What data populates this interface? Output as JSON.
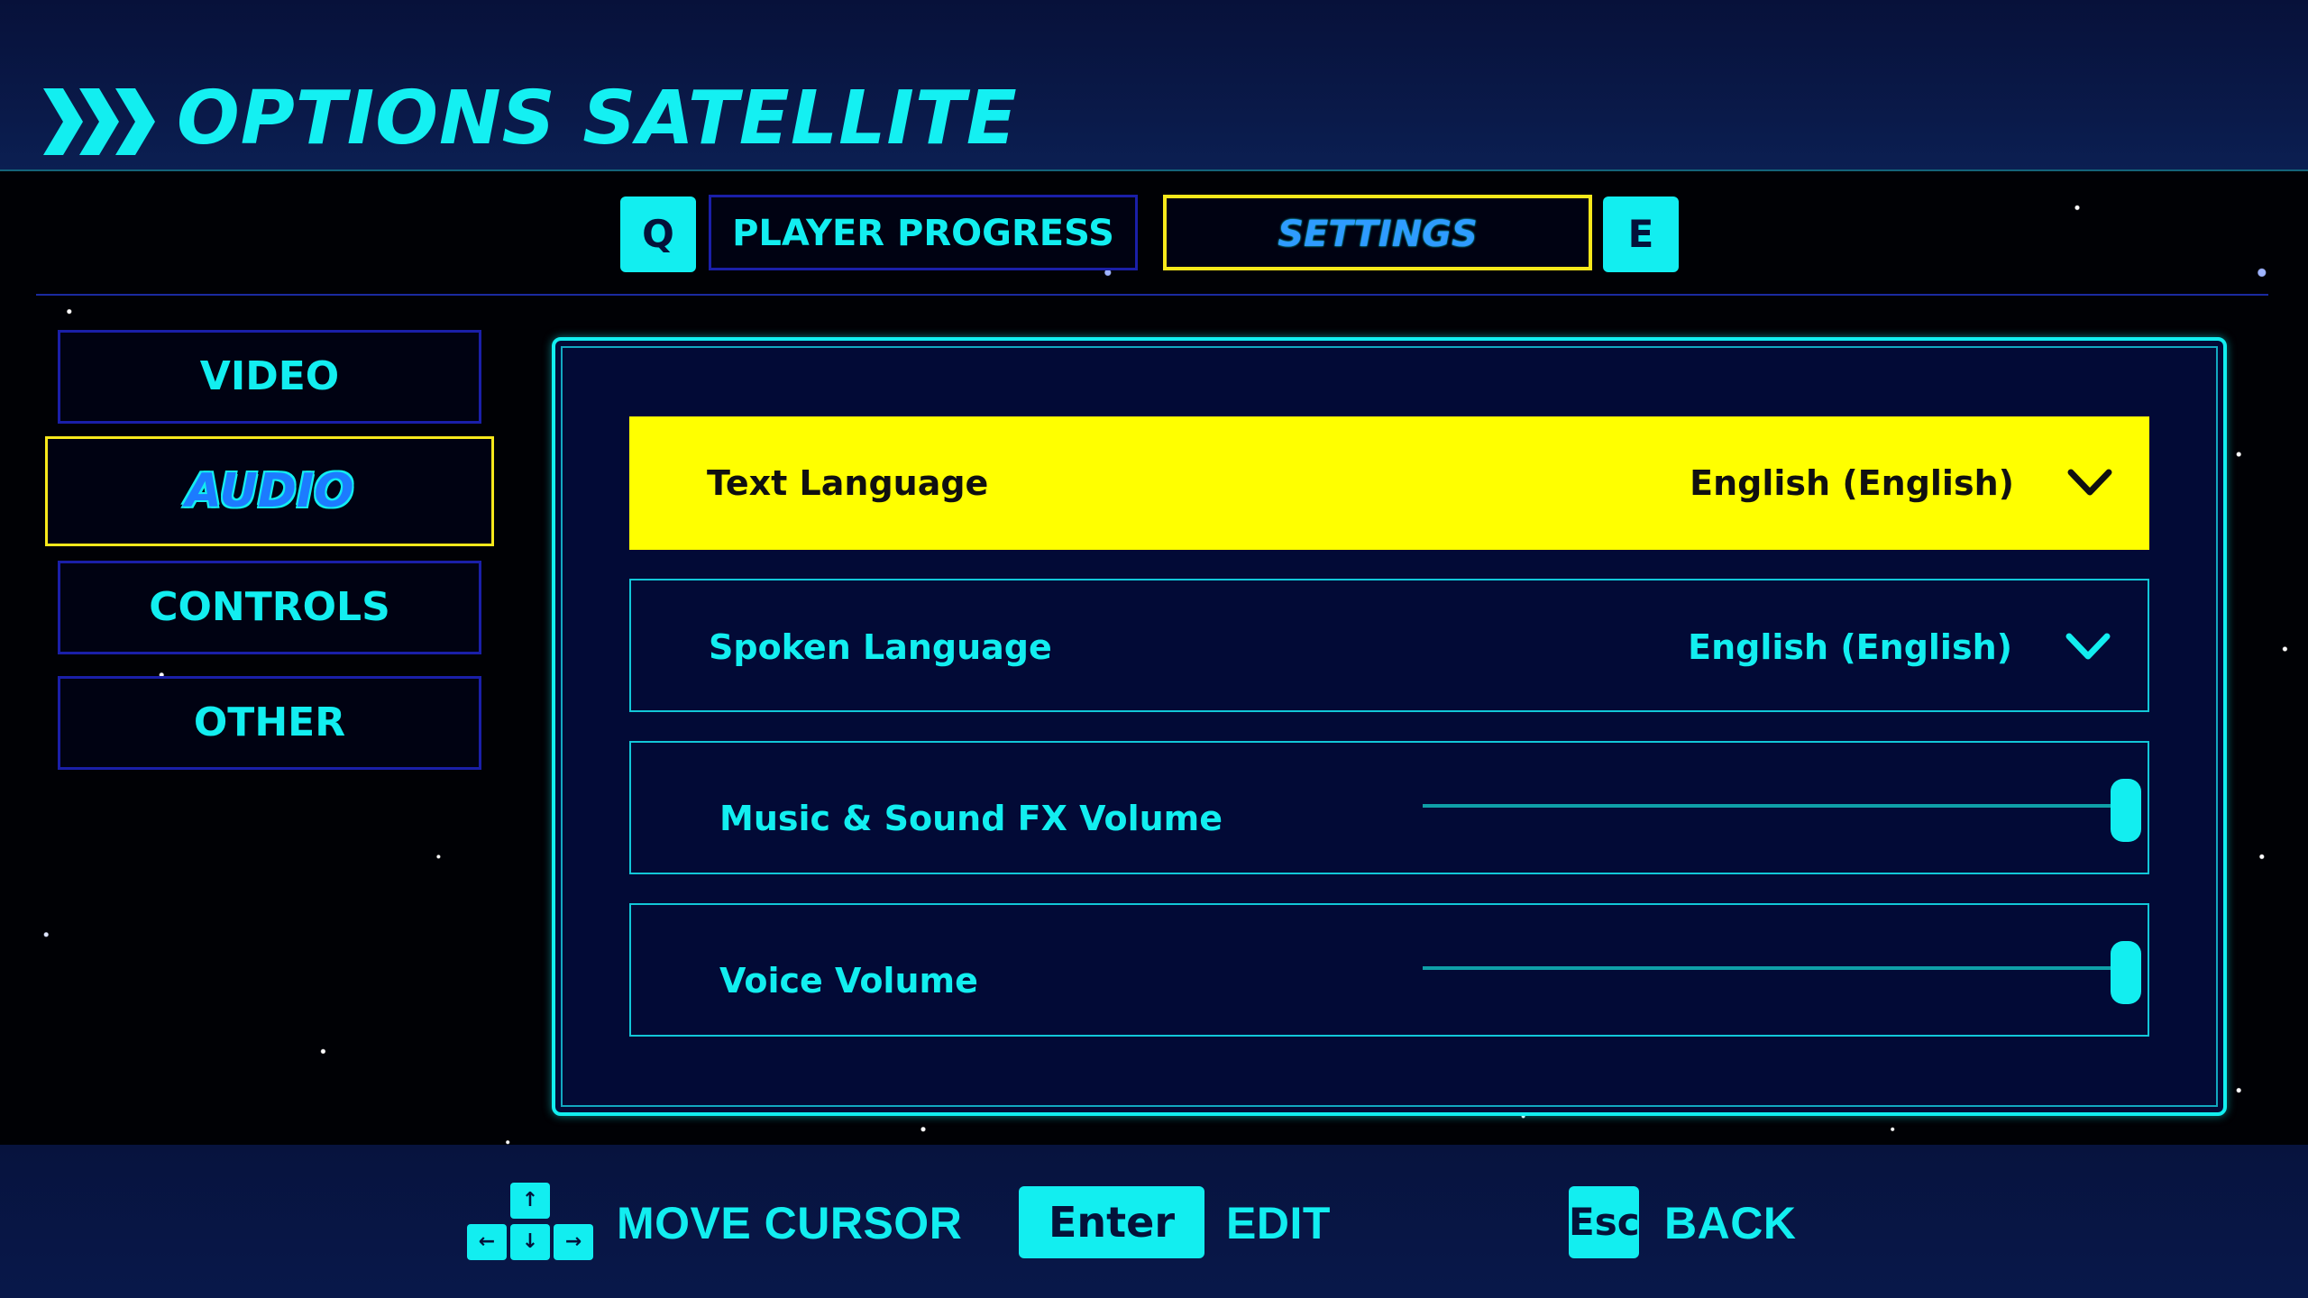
{
  "header": {
    "title": "OPTIONS SATELLITE",
    "icon": "triple-chevron-right-icon"
  },
  "tabs": {
    "prev_key": "Q",
    "next_key": "E",
    "items": [
      {
        "label": "PLAYER PROGRESS",
        "active": false
      },
      {
        "label": "SETTINGS",
        "active": true
      }
    ]
  },
  "sidebar": {
    "items": [
      {
        "label": "VIDEO",
        "active": false
      },
      {
        "label": "AUDIO",
        "active": true
      },
      {
        "label": "CONTROLS",
        "active": false
      },
      {
        "label": "OTHER",
        "active": false
      }
    ]
  },
  "settings": [
    {
      "label": "Text Language",
      "type": "dropdown",
      "value": "English (English)",
      "selected": true
    },
    {
      "label": "Spoken Language",
      "type": "dropdown",
      "value": "English (English)",
      "selected": false
    },
    {
      "label": "Music & Sound FX Volume",
      "type": "slider",
      "level": 1.0,
      "selected": false
    },
    {
      "label": "Voice Volume",
      "type": "slider",
      "level": 1.0,
      "selected": false
    }
  ],
  "footer": {
    "move": {
      "label": "MOVE CURSOR",
      "keys": [
        "↑",
        "←",
        "↓",
        "→"
      ]
    },
    "edit": {
      "key": "Enter",
      "label": "EDIT"
    },
    "back": {
      "key": "Esc",
      "label": "BACK"
    }
  },
  "colors": {
    "accent": "#12eef0",
    "highlight": "#ffff00",
    "selected_border": "#f7e81b",
    "panel_bg": "#020a36",
    "button_border": "#1a1fa8"
  }
}
